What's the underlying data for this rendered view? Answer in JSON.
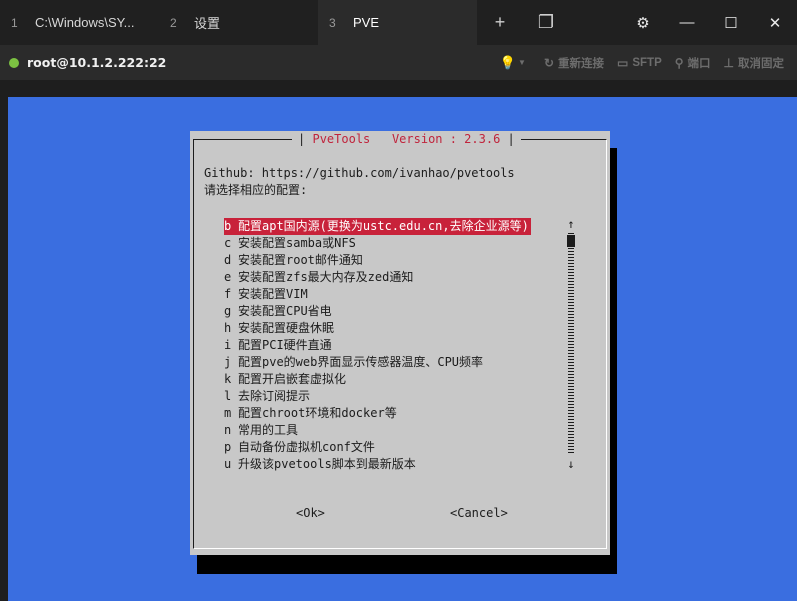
{
  "tabs": [
    {
      "num": "1",
      "title": "C:\\Windows\\SY..."
    },
    {
      "num": "2",
      "title": "设置"
    },
    {
      "num": "3",
      "title": "PVE"
    }
  ],
  "tab_tools": {
    "add": "+",
    "tabs_view": "❐"
  },
  "window": {
    "settings": "⚙",
    "minimize": "—",
    "maximize": "☐",
    "close": "✕"
  },
  "session": {
    "host": "root@10.1.2.222:22",
    "reconnect": "重新连接",
    "sftp": "SFTP",
    "port": "端口",
    "unpin": "取消固定"
  },
  "dialog": {
    "title": "PveTools   Version : 2.3.6",
    "github": "Github: https://github.com/ivanhao/pvetools",
    "prompt": "请选择相应的配置:",
    "items": [
      {
        "key": "b",
        "label": "配置apt国内源(更换为ustc.edu.cn,去除企业源等)",
        "selected": true
      },
      {
        "key": "c",
        "label": "安装配置samba或NFS"
      },
      {
        "key": "d",
        "label": "安装配置root邮件通知"
      },
      {
        "key": "e",
        "label": "安装配置zfs最大内存及zed通知"
      },
      {
        "key": "f",
        "label": "安装配置VIM"
      },
      {
        "key": "g",
        "label": "安装配置CPU省电"
      },
      {
        "key": "h",
        "label": "安装配置硬盘休眠"
      },
      {
        "key": "i",
        "label": "配置PCI硬件直通"
      },
      {
        "key": "j",
        "label": "配置pve的web界面显示传感器温度、CPU频率"
      },
      {
        "key": "k",
        "label": "配置开启嵌套虚拟化"
      },
      {
        "key": "l",
        "label": "去除订阅提示"
      },
      {
        "key": "m",
        "label": "配置chroot环境和docker等"
      },
      {
        "key": "n",
        "label": "常用的工具"
      },
      {
        "key": "p",
        "label": "自动备份虚拟机conf文件"
      },
      {
        "key": "u",
        "label": "升级该pvetools脚本到最新版本"
      }
    ],
    "scroll_up": "↑",
    "scroll_down": "↓",
    "ok": "<Ok>",
    "cancel": "<Cancel>"
  },
  "colors": {
    "terminal_bg": "#3a6ee0",
    "dialog_bg": "#c8c8c8",
    "title_red": "#c0243c",
    "selection_red": "#c8223a",
    "status_green": "#7cc242"
  }
}
